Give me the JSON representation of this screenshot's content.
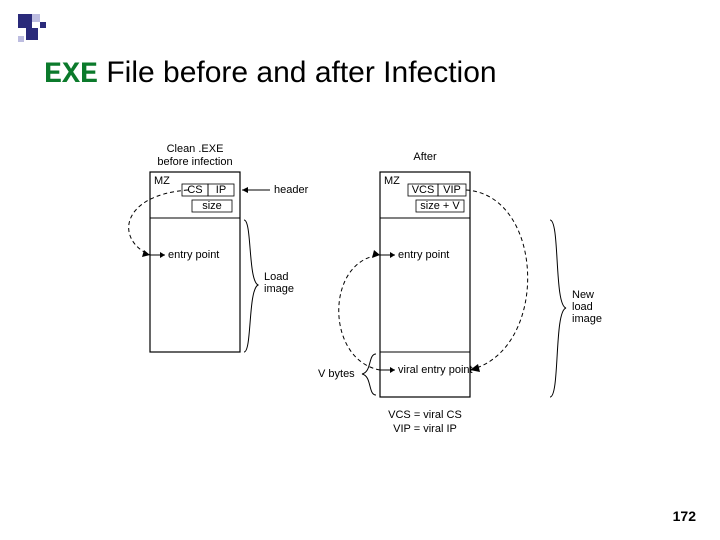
{
  "title": {
    "exe": "EXE",
    "rest": " File before and after Infection"
  },
  "page_number": "172",
  "diagram": {
    "left": {
      "caption": "Clean .EXE\nbefore infection",
      "hdr_left": "MZ",
      "hdr_cs": "CS",
      "hdr_ip": "IP",
      "hdr_size": "size",
      "entry_point": "entry point",
      "header_label": "header",
      "load_image_label": "Load\nimage"
    },
    "right": {
      "caption": "After",
      "hdr_left": "MZ",
      "hdr_cs": "VCS",
      "hdr_ip": "VIP",
      "hdr_size": "size + V",
      "entry_point": "entry point",
      "viral_entry_point": "viral entry point",
      "new_load_image_label": "New\nload\nimage",
      "vbytes_label": "V bytes"
    },
    "legend": {
      "line1": "VCS = viral CS",
      "line2": "VIP = viral IP"
    }
  }
}
